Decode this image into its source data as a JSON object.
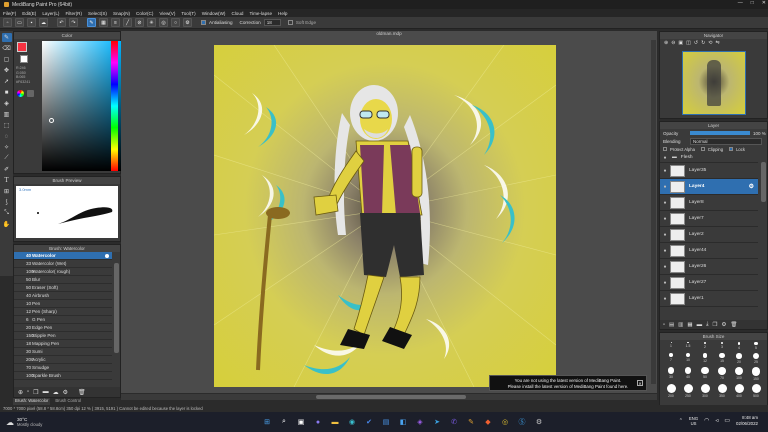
{
  "window": {
    "title": "MediBang Paint Pro (64bit)"
  },
  "menu": [
    "File(F)",
    "Edit(E)",
    "Layer(L)",
    "Filter(R)",
    "Select(S)",
    "Snap(N)",
    "Color(C)",
    "View(V)",
    "Tool(T)",
    "Window(W)",
    "Cloud",
    "Time-lapse",
    "Help"
  ],
  "toolbar": {
    "antialiasing_label": "Antialiasing",
    "correction_label": "Correction",
    "correction_value": "18",
    "soft_edge_label": "Soft Edge"
  },
  "color_panel": {
    "title": "Color",
    "values": [
      "R:246",
      "G:050",
      "B:065"
    ],
    "hex": "#F63241"
  },
  "brush_preview": {
    "title": "Brush Preview",
    "size_label": "3.0mm"
  },
  "brush_panel": {
    "title": "Brush: Watercolor",
    "items": [
      {
        "num": "40",
        "name": "Watercolor",
        "color": "#3a9ee0",
        "selected": true
      },
      {
        "num": "33",
        "name": "Watercolor (Wet)",
        "color": "#3a9ee0"
      },
      {
        "num": "100",
        "name": "Watercolor( rough)",
        "color": "#3a9ee0"
      },
      {
        "num": "50",
        "name": "Blur",
        "color": "#3a9ee0"
      },
      {
        "num": "50",
        "name": "Eraser (Soft)",
        "color": "#f2f2f2"
      },
      {
        "num": "40",
        "name": "Airbrush",
        "color": "#3a9ee0"
      },
      {
        "num": "10",
        "name": "Pen",
        "color": "#222222"
      },
      {
        "num": "12",
        "name": "Pen (Sharp)",
        "color": "#222222"
      },
      {
        "num": "6",
        "name": "G Pen",
        "color": "#d23a2a"
      },
      {
        "num": "20",
        "name": "Edge Pen",
        "color": "#3faa3f"
      },
      {
        "num": "150",
        "name": "Stipple Pen",
        "color": "#e0a030"
      },
      {
        "num": "18",
        "name": "Mapping Pen",
        "color": "#222222"
      },
      {
        "num": "30",
        "name": "Sumi",
        "color": "#222222"
      },
      {
        "num": "200",
        "name": "Acrylic",
        "color": "#d24a8a"
      },
      {
        "num": "70",
        "name": "Smudge",
        "color": "#3a9ee0"
      },
      {
        "num": "100",
        "name": "Sparkle Brush",
        "color": "#3a9ee0"
      }
    ],
    "tabs": [
      "Brush: Watercolor",
      "Brush Control"
    ]
  },
  "canvas": {
    "doc_tab": "oldman.mdp"
  },
  "navigator": {
    "title": "Navigator"
  },
  "layer_panel": {
    "title": "Layer",
    "opacity_label": "Opacity",
    "opacity_value": "100 %",
    "opacity_fraction": 1.0,
    "blending_label": "Blending",
    "blending_value": "Normal",
    "protect_alpha": "Protect Alpha",
    "clipping": "Clipping",
    "lock": "Lock",
    "layers": [
      {
        "name": "Flesh",
        "folder": true
      },
      {
        "name": "Layer35"
      },
      {
        "name": "Layer4",
        "selected": true
      },
      {
        "name": "Layer8"
      },
      {
        "name": "Layer7"
      },
      {
        "name": "Layer2"
      },
      {
        "name": "Layer44"
      },
      {
        "name": "Layer26"
      },
      {
        "name": "Layer27"
      },
      {
        "name": "Layer1"
      }
    ]
  },
  "brush_size": {
    "title": "Brush Size",
    "row1": [
      "1",
      "1.5",
      "2",
      "3",
      "4",
      "5"
    ],
    "row2": [
      "7",
      "10",
      "12",
      "15",
      "20",
      "25"
    ],
    "row3": [
      "30",
      "40",
      "50",
      "70",
      "100",
      "150"
    ],
    "row4": [
      "200",
      "250",
      "300",
      "350",
      "400",
      "500"
    ]
  },
  "notification": {
    "line1": "You are not using the latest version of MediBang Paint.",
    "line2": "Please install the latest version of MediBang Paint found here."
  },
  "status": {
    "text": "7000 * 7000 pixel  (58.8 * 58.8cm)  350 dpi  12 %  ( 3915, 5191 )   Cannot be edited because the layer is locked"
  },
  "taskbar": {
    "weather_temp": "30°C",
    "weather_desc": "Mostly cloudy",
    "lang1": "ENG",
    "lang2": "US",
    "time": "8:48 am",
    "date": "02/06/2022"
  }
}
